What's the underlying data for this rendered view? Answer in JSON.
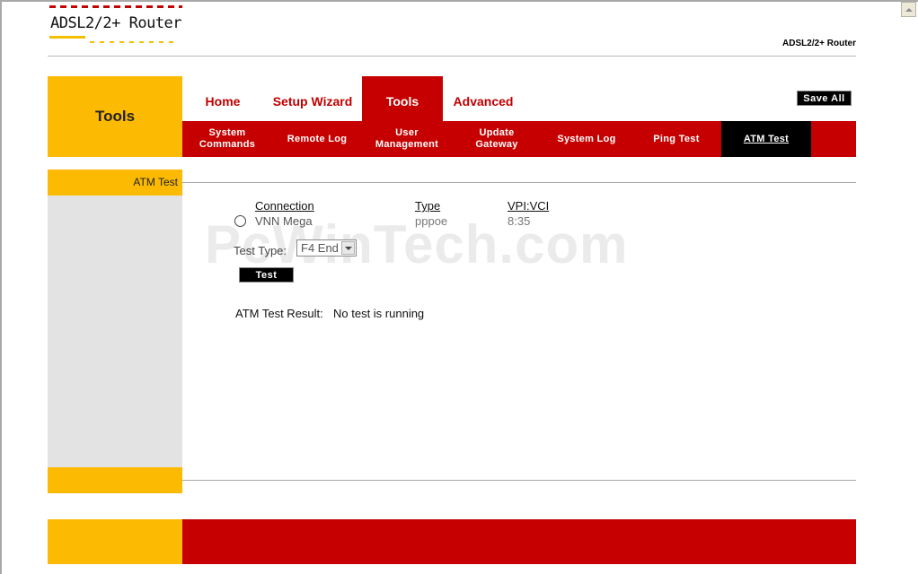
{
  "header": {
    "logo_text": "ADSL2/2+ Router",
    "brand_right": "ADSL2/2+ Router"
  },
  "section": {
    "title": "Tools"
  },
  "tabs": [
    {
      "label": "Home",
      "active": false
    },
    {
      "label": "Setup Wizard",
      "active": false
    },
    {
      "label": "Tools",
      "active": true
    },
    {
      "label": "Advanced",
      "active": false
    }
  ],
  "save_all_label": "Save All",
  "subnav": [
    {
      "label": "System Commands",
      "active": false
    },
    {
      "label": "Remote Log",
      "active": false
    },
    {
      "label": "User Management",
      "active": false
    },
    {
      "label": "Update Gateway",
      "active": false
    },
    {
      "label": "System Log",
      "active": false
    },
    {
      "label": "Ping Test",
      "active": false
    },
    {
      "label": "ATM Test",
      "active": true
    }
  ],
  "sidebar": {
    "heading": "ATM Test"
  },
  "connections": {
    "headers": {
      "connection": "Connection",
      "type": "Type",
      "vpivci": "VPI:VCI"
    },
    "rows": [
      {
        "name": "VNN Mega",
        "type": "pppoe",
        "vpivci": "8:35",
        "selected": false
      }
    ]
  },
  "test_type": {
    "label": "Test Type:",
    "selected": "F4 End"
  },
  "test_button_label": "Test",
  "result": {
    "label": "ATM Test Result:",
    "value": "No test is running"
  },
  "watermark": "PcWinTech.com",
  "colors": {
    "brand_red": "#c60000",
    "brand_yellow": "#fcba03",
    "sidebar_gray": "#e3e3e3"
  }
}
